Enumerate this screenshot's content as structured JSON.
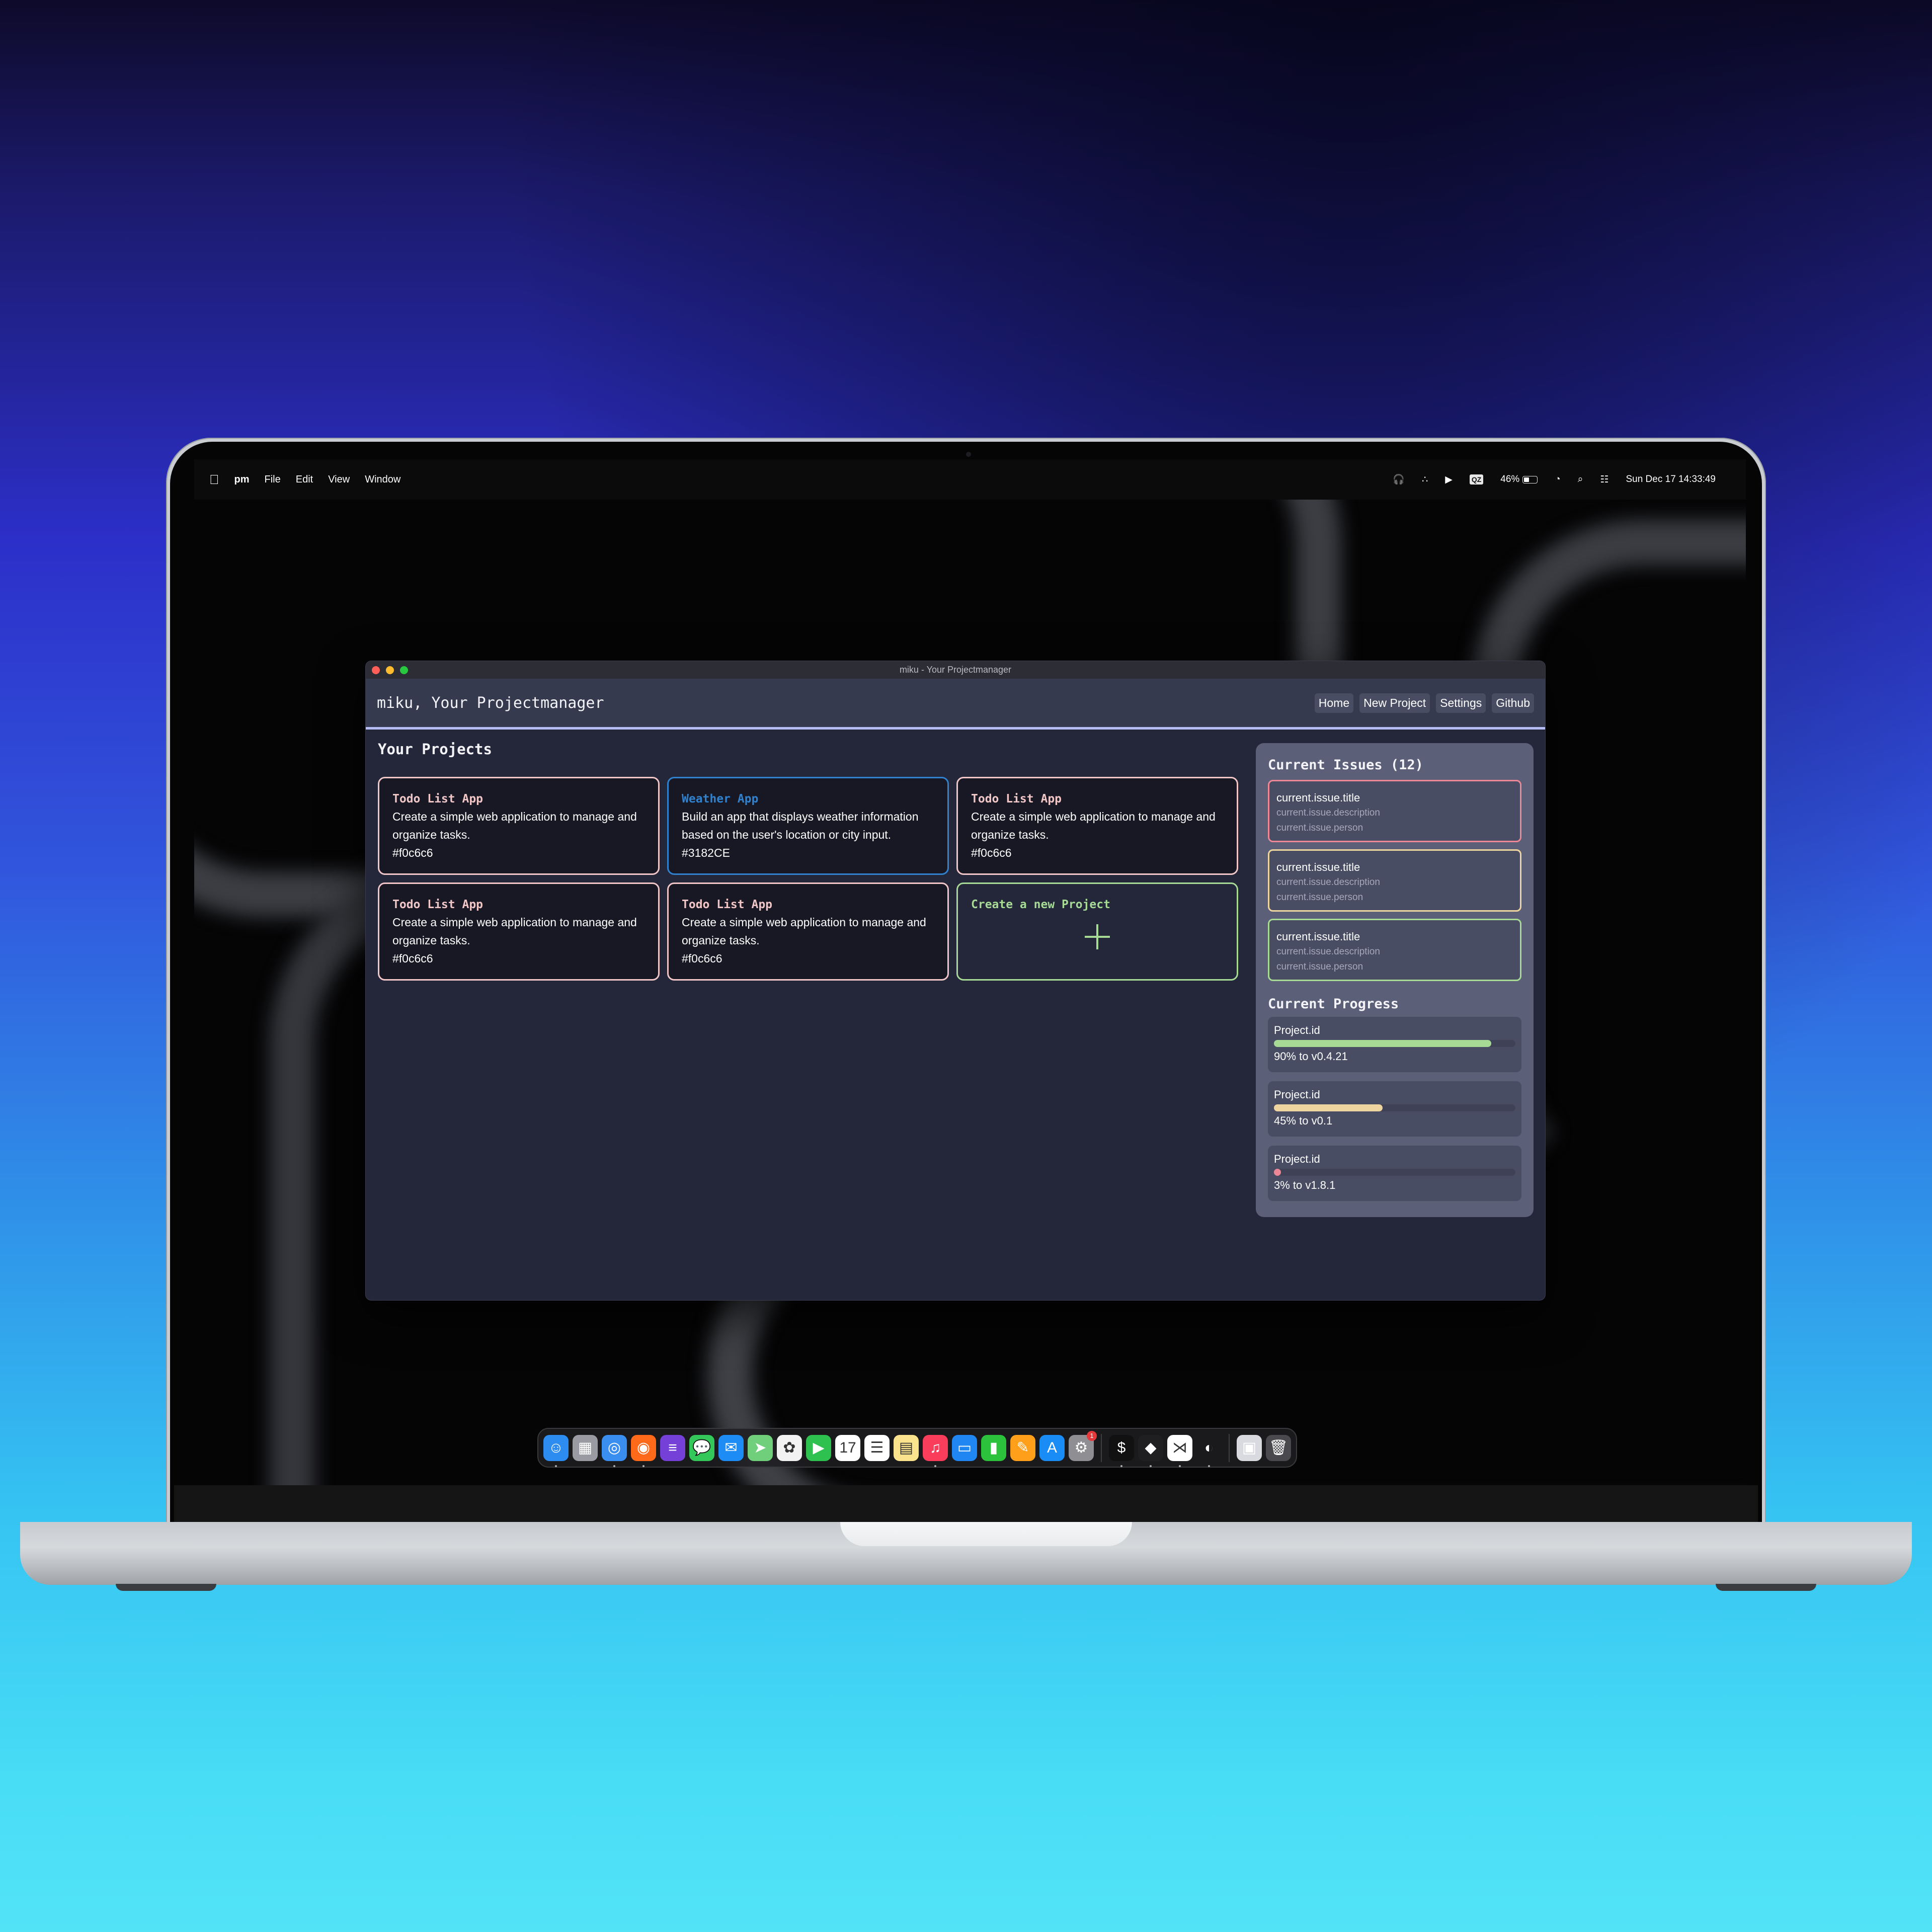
{
  "menubar": {
    "apple_icon": "apple-logo-icon",
    "app_name": "pm",
    "menus": [
      "File",
      "Edit",
      "View",
      "Window"
    ],
    "status": {
      "icons": [
        "airpods-icon",
        "dots-icon",
        "play-circle-icon"
      ],
      "input_badge": "QZ",
      "battery_percent": "46%",
      "battery_level": 0.46,
      "status_icons_after": [
        "wifi-icon",
        "search-icon",
        "control-center-icon"
      ],
      "datetime": "Sun Dec 17  14:33:49"
    }
  },
  "window": {
    "title": "miku - Your Projectmanager",
    "traffic_lights": {
      "close": "#ff5f57",
      "minimize": "#febc2e",
      "zoom": "#28c840"
    }
  },
  "header": {
    "brand": "miku, Your Projectmanager",
    "nav": [
      "Home",
      "New Project",
      "Settings",
      "Github"
    ]
  },
  "projects": {
    "title": "Your Projects",
    "items": [
      {
        "title": "Todo List App",
        "description": "Create a simple web application to manage and organize tasks.",
        "color": "#f0c6c6"
      },
      {
        "title": "Weather App",
        "description": "Build an app that displays weather information based on the user's location or city input.",
        "color": "#3182CE"
      },
      {
        "title": "Todo List App",
        "description": "Create a simple web application to manage and organize tasks.",
        "color": "#f0c6c6"
      },
      {
        "title": "Todo List App",
        "description": "Create a simple web application to manage and organize tasks.",
        "color": "#f0c6c6"
      },
      {
        "title": "Todo List App",
        "description": "Create a simple web application to manage and organize tasks.",
        "color": "#f0c6c6"
      }
    ],
    "create_label": "Create a new Project"
  },
  "issues": {
    "title": "Current Issues (12)",
    "items": [
      {
        "title": "current.issue.title",
        "description": "current.issue.description",
        "person": "current.issue.person",
        "color": "#ed8796"
      },
      {
        "title": "current.issue.title",
        "description": "current.issue.description",
        "person": "current.issue.person",
        "color": "#eed49f"
      },
      {
        "title": "current.issue.title",
        "description": "current.issue.description",
        "person": "current.issue.person",
        "color": "#a6da95"
      }
    ]
  },
  "progress": {
    "title": "Current Progress",
    "items": [
      {
        "name": "Project.id",
        "percent": 90,
        "label": "90% to v0.4.21",
        "color": "#a6da95"
      },
      {
        "name": "Project.id",
        "percent": 45,
        "label": "45% to v0.1",
        "color": "#eed49f"
      },
      {
        "name": "Project.id",
        "percent": 3,
        "label": "3% to v1.8.1",
        "color": "#ed8796"
      }
    ]
  },
  "dock": {
    "apps": [
      {
        "name": "finder-icon",
        "glyph": "☺",
        "bg": "#2d8cf0",
        "running": true
      },
      {
        "name": "launchpad-icon",
        "glyph": "▦",
        "bg": "#9a9aa2",
        "running": false
      },
      {
        "name": "safari-icon",
        "glyph": "◎",
        "bg": "#3a8ef0",
        "running": true
      },
      {
        "name": "firefox-icon",
        "glyph": "◉",
        "bg": "#ff6a1a",
        "running": true
      },
      {
        "name": "stack-app-icon",
        "glyph": "≡",
        "bg": "#7440d8",
        "running": false
      },
      {
        "name": "messages-icon",
        "glyph": "💬",
        "bg": "#34c759",
        "running": false
      },
      {
        "name": "mail-icon",
        "glyph": "✉",
        "bg": "#1e8cf5",
        "running": false
      },
      {
        "name": "maps-icon",
        "glyph": "➤",
        "bg": "#6fcf7a",
        "running": false
      },
      {
        "name": "photos-icon",
        "glyph": "✿",
        "bg": "#f2f2f2",
        "running": false
      },
      {
        "name": "facetime-icon",
        "glyph": "▶",
        "bg": "#2fc150",
        "running": false
      },
      {
        "name": "calendar-icon",
        "glyph": "17",
        "bg": "#ffffff",
        "running": false
      },
      {
        "name": "reminders-icon",
        "glyph": "☰",
        "bg": "#ffffff",
        "running": false
      },
      {
        "name": "notes-icon",
        "glyph": "▤",
        "bg": "#fbe38e",
        "running": false
      },
      {
        "name": "music-icon",
        "glyph": "♫",
        "bg": "#fa3d5a",
        "running": true
      },
      {
        "name": "keynote-icon",
        "glyph": "▭",
        "bg": "#1f86f2",
        "running": false
      },
      {
        "name": "numbers-icon",
        "glyph": "▮",
        "bg": "#2cc23b",
        "running": false
      },
      {
        "name": "pages-icon",
        "glyph": "✎",
        "bg": "#ff9f1a",
        "running": false
      },
      {
        "name": "app-store-icon",
        "glyph": "A",
        "bg": "#1a8cf5",
        "running": false
      },
      {
        "name": "system-settings-icon",
        "glyph": "⚙",
        "bg": "#8e8e93",
        "running": false,
        "badge": "1"
      }
    ],
    "apps2": [
      {
        "name": "terminal-icon",
        "glyph": "$",
        "bg": "#111111",
        "running": true
      },
      {
        "name": "obsidian-icon",
        "glyph": "◆",
        "bg": "#1f1f22",
        "running": true
      },
      {
        "name": "vscode-icon",
        "glyph": "⋊",
        "bg": "#ffffff",
        "running": true
      },
      {
        "name": "tailscale-icon",
        "glyph": "◐",
        "bg": "#1a1a1c",
        "running": true
      }
    ],
    "apps3": [
      {
        "name": "downloads-stack-icon",
        "glyph": "▣",
        "bg": "#d9d9e0",
        "running": false
      },
      {
        "name": "trash-icon",
        "glyph": "🗑",
        "bg": "#4a4a4e",
        "running": false
      }
    ]
  }
}
